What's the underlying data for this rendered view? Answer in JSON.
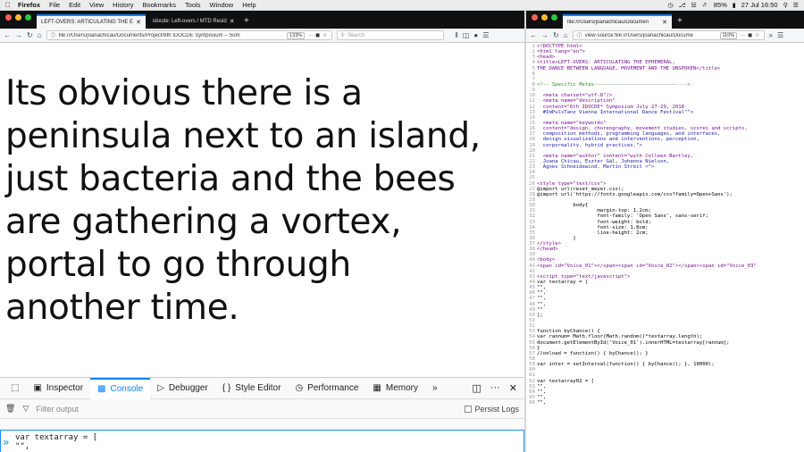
{
  "menubar": {
    "app": "Firefox",
    "items": [
      "File",
      "Edit",
      "View",
      "History",
      "Bookmarks",
      "Tools",
      "Window",
      "Help"
    ],
    "battery": "85%",
    "datetime": "27 Jul 16:50"
  },
  "left_window": {
    "tabs": [
      {
        "label": "LEFT-OVERS: ARTICULATING THE E",
        "active": true
      },
      {
        "label": "idocde: Left-overs / MTD Resid",
        "active": false
      }
    ],
    "url": "file:///Users/joanachicau/Documents/Project/6th IDOCDE Symposium – Sum",
    "zoom": "133%",
    "search_placeholder": "Search",
    "poem_lines": [
      "Its obvious there is a",
      "peninsula next to an island,",
      "just bacteria and the bees",
      "are gathering a vortex,",
      "portal to go through",
      "another time."
    ]
  },
  "devtools": {
    "tabs": [
      {
        "label": "Inspector",
        "icon": "inspector-icon",
        "active": false
      },
      {
        "label": "Console",
        "icon": "console-icon",
        "active": true
      },
      {
        "label": "Debugger",
        "icon": "debugger-icon",
        "active": false
      },
      {
        "label": "Style Editor",
        "icon": "style-editor-icon",
        "active": false
      },
      {
        "label": "Performance",
        "icon": "performance-icon",
        "active": false
      },
      {
        "label": "Memory",
        "icon": "memory-icon",
        "active": false
      }
    ],
    "filter_placeholder": "Filter output",
    "persist_logs": "Persist Logs",
    "input_lines": [
      "var textarray = [",
      "\"\",",
      "…"
    ]
  },
  "right_window": {
    "tab_label": "file:///Users/joanachicau/Documen",
    "url": "view-source:file:///Users/joanachicau/Docume",
    "zoom": "110%",
    "source_lines": [
      {
        "n": "1",
        "t": "<!DOCTYPE html>",
        "c": "doc"
      },
      {
        "n": "2",
        "t": "<html lang=\"en\">",
        "c": "tag"
      },
      {
        "n": "3",
        "t": "<head>",
        "c": "tag"
      },
      {
        "n": "4",
        "t": "<title>LEFT-OVERS: ARTICULATING THE EPHEMERAL,",
        "c": "tag"
      },
      {
        "n": "5",
        "t": "THE DANCE BETWEEN LANGUAGE, MOVEMENT AND THE UNSPOKEN</title>",
        "c": "tag"
      },
      {
        "n": "6",
        "t": "",
        "c": "plain"
      },
      {
        "n": "7",
        "t": "",
        "c": "plain"
      },
      {
        "n": "8",
        "t": "<!-- Specific Metas———————————————————————————— -->",
        "c": "cmt"
      },
      {
        "n": "9",
        "t": "",
        "c": "plain"
      },
      {
        "n": "10",
        "t": "  <meta charset=\"utf-8\"/>",
        "c": "tag"
      },
      {
        "n": "11",
        "t": "  <meta name=\"description\"",
        "c": "tag"
      },
      {
        "n": "12",
        "t": "  content=\"6th IDOCDE* Symposium July 27-29, 2018",
        "c": "tag"
      },
      {
        "n": "13",
        "t": "  #ImPulsTanz Vienna International Dance Festival\"\">",
        "c": "str"
      },
      {
        "n": "14",
        "t": "",
        "c": "plain"
      },
      {
        "n": "15",
        "t": "  <meta name=\"keywords\"",
        "c": "tag"
      },
      {
        "n": "16",
        "t": "  content=\"design, choreography, movement studies, scores and scripts,",
        "c": "tag"
      },
      {
        "n": "17",
        "t": "  composition methods, programming languages, and interfaces,",
        "c": "str"
      },
      {
        "n": "18",
        "t": "  design visualizations and interventions, perception,",
        "c": "str"
      },
      {
        "n": "19",
        "t": "  corporeality, hybrid practices.\">",
        "c": "str"
      },
      {
        "n": "20",
        "t": "",
        "c": "plain"
      },
      {
        "n": "21",
        "t": "  <meta name=\"author\" content=\"with Colleen Bartley,",
        "c": "tag"
      },
      {
        "n": "22",
        "t": "  Joana Chicau, Eszter Gál, Johanna Nielson,",
        "c": "str"
      },
      {
        "n": "23",
        "t": "  Agnes Schneidewind, Martin Streit <\">",
        "c": "str"
      },
      {
        "n": "24",
        "t": "",
        "c": "plain"
      },
      {
        "n": "25",
        "t": "",
        "c": "plain"
      },
      {
        "n": "26",
        "t": "<style type=\"text/css\">",
        "c": "tag"
      },
      {
        "n": "27",
        "t": "@import url(reset_meyer.css);",
        "c": "plain"
      },
      {
        "n": "28",
        "t": "@import url('https://fonts.googleapis.com/css?family=Open+Sans');",
        "c": "plain"
      },
      {
        "n": "29",
        "t": "",
        "c": "plain"
      },
      {
        "n": "30",
        "t": "            body{",
        "c": "plain"
      },
      {
        "n": "31",
        "t": "                    margin-top: 1.2cm;",
        "c": "plain"
      },
      {
        "n": "32",
        "t": "                    font-family: 'Open Sans', sans-serif;",
        "c": "plain"
      },
      {
        "n": "33",
        "t": "                    font-weight: bold;",
        "c": "plain"
      },
      {
        "n": "34",
        "t": "                    font-size: 1.8cm;",
        "c": "plain"
      },
      {
        "n": "35",
        "t": "                    line-height: 2cm;",
        "c": "plain"
      },
      {
        "n": "36",
        "t": "            }",
        "c": "plain"
      },
      {
        "n": "37",
        "t": "</style>",
        "c": "tag"
      },
      {
        "n": "38",
        "t": "</head>",
        "c": "tag"
      },
      {
        "n": "39",
        "t": "",
        "c": "plain"
      },
      {
        "n": "40",
        "t": "<body>",
        "c": "tag"
      },
      {
        "n": "41",
        "t": "<span id=\"Voice_01\"></span><span id=\"Voice_02\"></span><span id=\"Voice_03\"",
        "c": "tag"
      },
      {
        "n": "42",
        "t": "",
        "c": "plain"
      },
      {
        "n": "43",
        "t": "<script type=\"text/javascript\">",
        "c": "tag"
      },
      {
        "n": "44",
        "t": "var textarray = [",
        "c": "plain"
      },
      {
        "n": "45",
        "t": "\"\",",
        "c": "plain"
      },
      {
        "n": "46",
        "t": "\"\",",
        "c": "plain"
      },
      {
        "n": "47",
        "t": "\"\",",
        "c": "plain"
      },
      {
        "n": "48",
        "t": "\"\",",
        "c": "plain"
      },
      {
        "n": "49",
        "t": "\"\"",
        "c": "plain"
      },
      {
        "n": "50",
        "t": "];",
        "c": "plain"
      },
      {
        "n": "51",
        "t": "",
        "c": "plain"
      },
      {
        "n": "52",
        "t": "",
        "c": "plain"
      },
      {
        "n": "53",
        "t": "function byChance() {",
        "c": "plain"
      },
      {
        "n": "54",
        "t": "var rannum= Math.floor(Math.random()*textarray.length);",
        "c": "plain"
      },
      {
        "n": "55",
        "t": "document.getElementById('Voice_01').innerHTML=textarray[rannum];",
        "c": "plain"
      },
      {
        "n": "56",
        "t": "}",
        "c": "plain"
      },
      {
        "n": "57",
        "t": "//onload = function() { byChance(); }",
        "c": "plain"
      },
      {
        "n": "58",
        "t": "",
        "c": "plain"
      },
      {
        "n": "59",
        "t": "var inter = setInterval(function() { byChance(); }, 10000);",
        "c": "plain"
      },
      {
        "n": "60",
        "t": "",
        "c": "plain"
      },
      {
        "n": "61",
        "t": "",
        "c": "plain"
      },
      {
        "n": "62",
        "t": "var textarray02 = [",
        "c": "plain"
      },
      {
        "n": "63",
        "t": "\"\",",
        "c": "plain"
      },
      {
        "n": "64",
        "t": "\"\",",
        "c": "plain"
      },
      {
        "n": "65",
        "t": "\"\",",
        "c": "plain"
      },
      {
        "n": "66",
        "t": "\"\",",
        "c": "plain"
      }
    ]
  },
  "colors": {
    "accent": "#0a84ff",
    "tab_strip": "#0f1011",
    "close": "#ff5f57",
    "minimize": "#febc2e",
    "maximize": "#28c840"
  }
}
